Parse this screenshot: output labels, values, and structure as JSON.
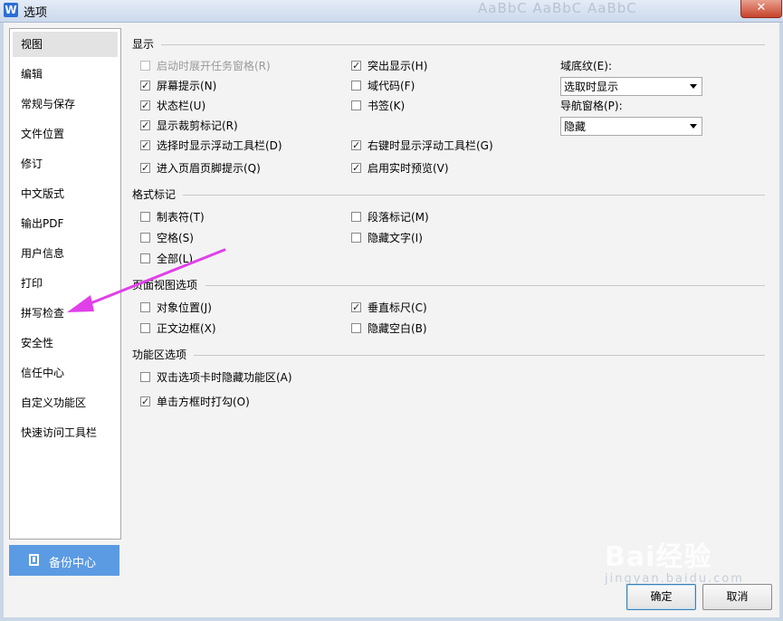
{
  "window": {
    "title": "选项",
    "app_icon_letter": "W",
    "ghost_text": "AaBbC AaBbC AaBbC",
    "close_label": "✕"
  },
  "sidebar": {
    "items": [
      {
        "label": "视图"
      },
      {
        "label": "编辑"
      },
      {
        "label": "常规与保存"
      },
      {
        "label": "文件位置"
      },
      {
        "label": "修订"
      },
      {
        "label": "中文版式"
      },
      {
        "label": "输出PDF"
      },
      {
        "label": "用户信息"
      },
      {
        "label": "打印"
      },
      {
        "label": "拼写检查"
      },
      {
        "label": "安全性"
      },
      {
        "label": "信任中心"
      },
      {
        "label": "自定义功能区"
      },
      {
        "label": "快速访问工具栏"
      }
    ],
    "selected": "视图",
    "backup_button": "备份中心"
  },
  "sections": {
    "display": {
      "title": "显示",
      "col1": [
        {
          "label": "启动时展开任务窗格(R)",
          "checked": false,
          "disabled": true
        },
        {
          "label": "屏幕提示(N)",
          "checked": true
        },
        {
          "label": "状态栏(U)",
          "checked": true
        },
        {
          "label": "显示裁剪标记(R)",
          "checked": true
        },
        {
          "label": "选择时显示浮动工具栏(D)",
          "checked": true
        },
        {
          "label": "进入页眉页脚提示(Q)",
          "checked": true
        }
      ],
      "col2": [
        {
          "label": "突出显示(H)",
          "checked": true
        },
        {
          "label": "域代码(F)",
          "checked": false
        },
        {
          "label": "书签(K)",
          "checked": false
        },
        {
          "label": "右键时显示浮动工具栏(G)",
          "checked": true
        },
        {
          "label": "启用实时预览(V)",
          "checked": true
        }
      ],
      "field_shading": {
        "label": "域底纹(E):",
        "value": "选取时显示"
      },
      "nav_pane": {
        "label": "导航窗格(P):",
        "value": "隐藏"
      }
    },
    "format_marks": {
      "title": "格式标记",
      "col1": [
        {
          "label": "制表符(T)",
          "checked": false
        },
        {
          "label": "空格(S)",
          "checked": false
        },
        {
          "label": "全部(L)",
          "checked": false
        }
      ],
      "col2": [
        {
          "label": "段落标记(M)",
          "checked": false
        },
        {
          "label": "隐藏文字(I)",
          "checked": false
        }
      ]
    },
    "page_view": {
      "title": "页面视图选项",
      "col1": [
        {
          "label": "对象位置(J)",
          "checked": false
        },
        {
          "label": "正文边框(X)",
          "checked": false
        }
      ],
      "col2": [
        {
          "label": "垂直标尺(C)",
          "checked": true
        },
        {
          "label": "隐藏空白(B)",
          "checked": false
        }
      ]
    },
    "ribbon": {
      "title": "功能区选项",
      "items": [
        {
          "label": "双击选项卡时隐藏功能区(A)",
          "checked": false
        },
        {
          "label": "单击方框时打勾(O)",
          "checked": true
        }
      ]
    }
  },
  "buttons": {
    "ok": "确定",
    "cancel": "取消"
  },
  "watermark": {
    "brand": "Bai经验",
    "url": "jingyan.baidu.com"
  },
  "colors": {
    "accent": "#5b9be3",
    "arrow": "#e040e8"
  }
}
